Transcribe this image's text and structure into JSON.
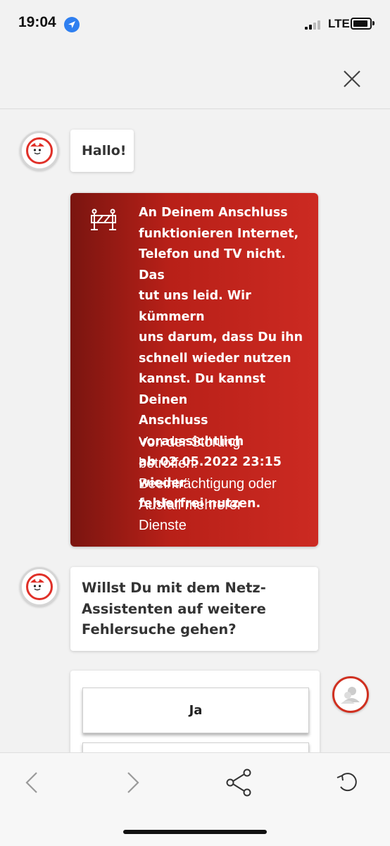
{
  "status": {
    "time": "19:04",
    "network": "LTE"
  },
  "chat": {
    "greeting": "Hallo!",
    "alert": {
      "message": "An Deinem Anschluss\nfunktionieren Internet,\nTelefon und TV nicht. Das\ntut uns leid. Wir kümmern\nuns darum, dass Du ihn\nschnell wieder nutzen\nkannst. Du kannst Deinen\nAnschluss voraussichtlich\nab 02.05.2022 23:15 wieder\nfehlerfrei nutzen.",
      "affected": "Von der Störung\nbetroffen:\nBeeinträchtigung oder\nAusfall mehrerer\nDienste"
    },
    "question": "Willst Du mit dem Netz-\nAssistenten auf weitere\nFehlersuche gehen?",
    "options": [
      "Ja",
      ""
    ]
  },
  "icons": {
    "close": "close-icon",
    "back": "chevron-left-icon",
    "forward": "chevron-right-icon",
    "share": "share-icon",
    "reload": "reload-icon",
    "alert": "roadblock-icon",
    "bot": "bot-avatar-icon",
    "user": "user-avatar-icon"
  },
  "colors": {
    "accent": "#e60000",
    "alert_dark": "#7a1510",
    "alert_light": "#cc2a22"
  }
}
